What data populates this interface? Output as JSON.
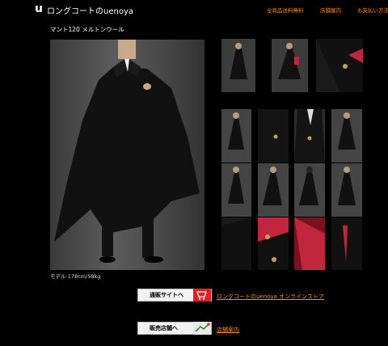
{
  "header": {
    "logo_mark": "u",
    "brand": "ロングコートのuenoya",
    "nav": [
      {
        "label": "全商品送料無料"
      },
      {
        "label": "店舗案内"
      },
      {
        "label": "お支払い方法"
      }
    ]
  },
  "product": {
    "title": "マント120 メルトンウール",
    "caption": "モデル:178cm/58kg"
  },
  "cta": {
    "online": {
      "button": "通販サイトへ",
      "link": "ロングコートのuenoya オンラインストア"
    },
    "store": {
      "button": "販売店舗へ",
      "link": "店舗案内"
    }
  },
  "colors": {
    "accent": "#ff8a00",
    "background": "#000000",
    "lining": "#c1263c"
  }
}
